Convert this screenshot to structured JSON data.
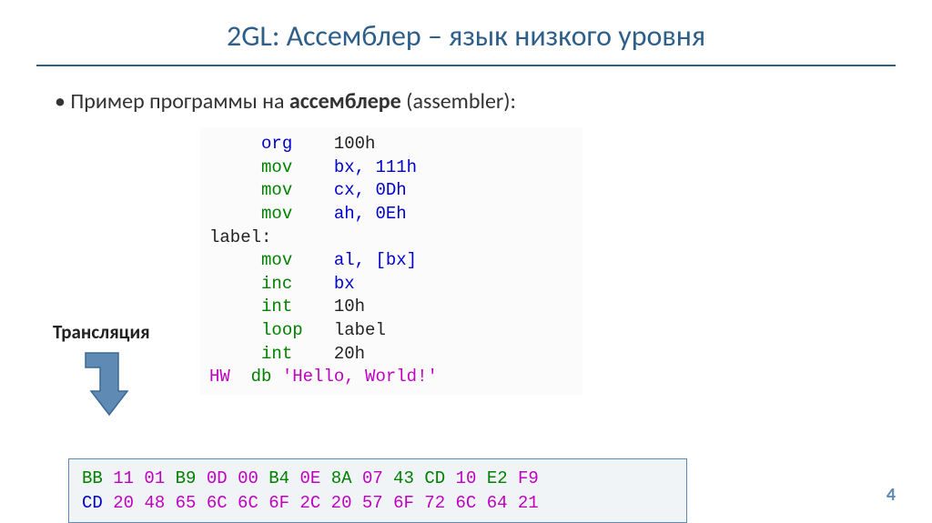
{
  "title": "2GL: Ассемблер – язык низкого уровня",
  "bullet": {
    "prefix": "Пример программы на ",
    "bold": "ассемблере",
    "suffix": " (assembler):"
  },
  "code": [
    {
      "indent": "     ",
      "mnemonic": "org",
      "mClass": "c-blue",
      "args": "100h",
      "aClass": "c-black"
    },
    {
      "indent": "     ",
      "mnemonic": "mov",
      "mClass": "c-green",
      "args": "bx, 111h",
      "aClass": "c-blue"
    },
    {
      "indent": "     ",
      "mnemonic": "mov",
      "mClass": "c-green",
      "args": "cx, 0Dh",
      "aClass": "c-blue"
    },
    {
      "indent": "     ",
      "mnemonic": "mov",
      "mClass": "c-green",
      "args": "ah, 0Eh",
      "aClass": "c-blue"
    },
    {
      "indent": "",
      "mnemonic": "label:",
      "mClass": "c-black",
      "args": "",
      "aClass": "c-black"
    },
    {
      "indent": "     ",
      "mnemonic": "mov",
      "mClass": "c-green",
      "args": "al, [bx]",
      "aClass": "c-blue"
    },
    {
      "indent": "     ",
      "mnemonic": "inc",
      "mClass": "c-green",
      "args": "bx",
      "aClass": "c-blue"
    },
    {
      "indent": "     ",
      "mnemonic": "int",
      "mClass": "c-green",
      "args": "10h",
      "aClass": "c-black"
    },
    {
      "indent": "     ",
      "mnemonic": "loop",
      "mClass": "c-green",
      "args": "label",
      "aClass": "c-black"
    },
    {
      "indent": "     ",
      "mnemonic": "int",
      "mClass": "c-green",
      "args": "20h",
      "aClass": "c-black"
    }
  ],
  "code_last": {
    "label": "HW",
    "directive": "db",
    "string": "'Hello, World!'"
  },
  "translation_label": "Трансляция",
  "hex": {
    "line1": [
      {
        "t": "BB",
        "c": "c-green"
      },
      {
        "t": "11 01",
        "c": "c-magenta"
      },
      {
        "t": "B9",
        "c": "c-green"
      },
      {
        "t": "0D 00",
        "c": "c-magenta"
      },
      {
        "t": "B4",
        "c": "c-green"
      },
      {
        "t": "0E",
        "c": "c-magenta"
      },
      {
        "t": "8A",
        "c": "c-green"
      },
      {
        "t": "07",
        "c": "c-magenta"
      },
      {
        "t": "43",
        "c": "c-green"
      },
      {
        "t": "CD",
        "c": "c-green"
      },
      {
        "t": "10",
        "c": "c-magenta"
      },
      {
        "t": "E2",
        "c": "c-green"
      },
      {
        "t": "F9",
        "c": "c-magenta"
      }
    ],
    "line2": [
      {
        "t": "CD",
        "c": "c-blue"
      },
      {
        "t": "20",
        "c": "c-magenta"
      },
      {
        "t": "48 65 6C 6C 6F 2C 20 57 6F 72 6C 64 21",
        "c": "c-magenta"
      }
    ]
  },
  "page_number": "4"
}
